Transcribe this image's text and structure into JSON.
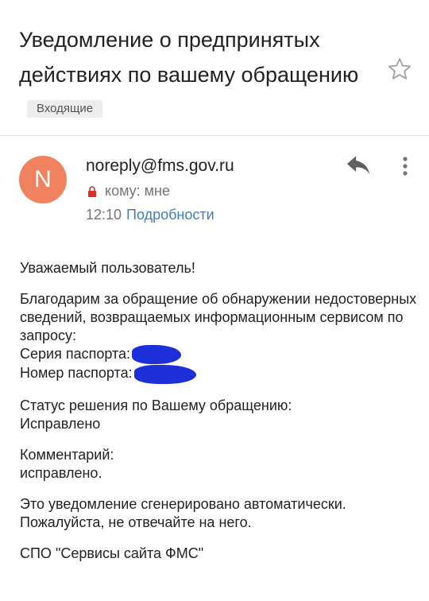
{
  "email": {
    "subject": "Уведомление о предпринятых действиях по вашему обращению",
    "label": "Входящие",
    "avatar_letter": "N",
    "sender": "noreply@fms.gov.ru",
    "recipient": "кому: мне",
    "time": "12:10",
    "details_link": "Подробности"
  },
  "body": {
    "greeting": "Уважаемый пользователь!",
    "intro": "Благодарим за обращение об обнаружении недостоверных сведений, возвращаемых информационным сервисом по запросу:",
    "passport_series_label": "Серия паспорта:",
    "passport_number_label": "Номер паспорта:",
    "status_label": "Статус решения по Вашему обращению:",
    "status_value": "Исправлено",
    "comment_label": "Комментарий:",
    "comment_value": "исправлено.",
    "auto_notice_1": "Это уведомление сгенерировано автоматически.",
    "auto_notice_2": "Пожалуйста, не отвечайте на него.",
    "signature": "СПО \"Сервисы сайта ФМС\""
  },
  "colors": {
    "avatar": "#f0825f",
    "link": "#3d7fc4",
    "redaction": "#1c2fd8"
  },
  "icons": {
    "star": "star-outline-icon",
    "reply": "reply-icon",
    "more": "more-vert-icon",
    "lock": "lock-icon"
  }
}
